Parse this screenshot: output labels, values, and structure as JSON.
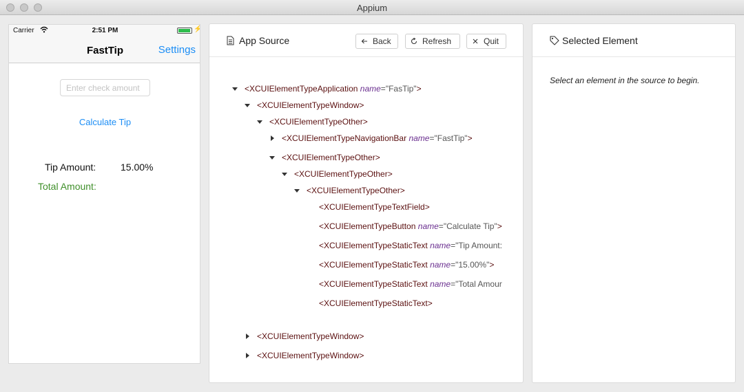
{
  "window": {
    "title": "Appium"
  },
  "device": {
    "carrier": "Carrier",
    "time": "2:51 PM",
    "nav_title": "FastTip",
    "nav_settings": "Settings",
    "check_placeholder": "Enter check amount",
    "check_value": "",
    "calculate_label": "Calculate Tip",
    "tip_label": "Tip Amount:",
    "tip_value": "15.00%",
    "total_label": "Total Amount:",
    "colors": {
      "link": "#1b8df5",
      "total": "#3f8f2a"
    }
  },
  "source_panel": {
    "title": "App Source",
    "back_label": "Back",
    "refresh_label": "Refresh",
    "quit_label": "Quit",
    "tree": [
      {
        "tag": "<XCUIElementTypeApplication",
        "attr": "name",
        "val": "\"FasTip\"",
        "close": ">",
        "expander": "expanded"
      },
      {
        "tag": "<XCUIElementTypeWindow",
        "attr": "",
        "val": "",
        "close": ">",
        "expander": "expanded"
      },
      {
        "tag": "<XCUIElementTypeOther",
        "attr": "",
        "val": "",
        "close": ">",
        "expander": "expanded"
      },
      {
        "tag": "<XCUIElementTypeNavigationBar",
        "attr": "name",
        "val": "\"FastTip\"",
        "close": ">",
        "expander": "collapsed"
      },
      {
        "tag": "<XCUIElementTypeOther",
        "attr": "",
        "val": "",
        "close": ">",
        "expander": "expanded"
      },
      {
        "tag": "<XCUIElementTypeOther",
        "attr": "",
        "val": "",
        "close": ">",
        "expander": "expanded"
      },
      {
        "tag": "<XCUIElementTypeOther",
        "attr": "",
        "val": "",
        "close": ">",
        "expander": "expanded"
      },
      {
        "tag": "<XCUIElementTypeTextField",
        "attr": "",
        "val": "",
        "close": ">",
        "expander": "none"
      },
      {
        "tag": "<XCUIElementTypeButton",
        "attr": "name",
        "val": "\"Calculate Tip\"",
        "close": ">",
        "expander": "none"
      },
      {
        "tag": "<XCUIElementTypeStaticText",
        "attr": "name",
        "val": "\"Tip Amount:",
        "close": "",
        "expander": "none"
      },
      {
        "tag": "<XCUIElementTypeStaticText",
        "attr": "name",
        "val": "\"15.00%\"",
        "close": ">",
        "expander": "none"
      },
      {
        "tag": "<XCUIElementTypeStaticText",
        "attr": "name",
        "val": "\"Total Amour",
        "close": "",
        "expander": "none"
      },
      {
        "tag": "<XCUIElementTypeStaticText",
        "attr": "",
        "val": "",
        "close": ">",
        "expander": "none"
      },
      {
        "tag": "<XCUIElementTypeWindow",
        "attr": "",
        "val": "",
        "close": ">",
        "expander": "collapsed"
      },
      {
        "tag": "<XCUIElementTypeWindow",
        "attr": "",
        "val": "",
        "close": ">",
        "expander": "collapsed"
      }
    ]
  },
  "selected_panel": {
    "title": "Selected Element",
    "hint": "Select an element in the source to begin."
  },
  "icons": {
    "doc": "document-icon",
    "tag": "tag-icon",
    "back": "arrow-left-icon",
    "refresh": "refresh-icon",
    "quit": "close-icon",
    "wifi": "wifi-icon",
    "battery": "battery-icon"
  }
}
